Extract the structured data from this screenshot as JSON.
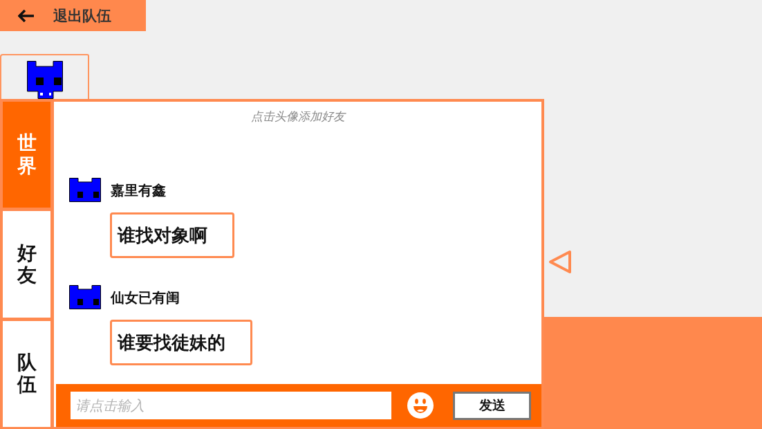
{
  "header": {
    "exit_button": "退出队伍"
  },
  "chat": {
    "tabs": [
      {
        "label": "世界",
        "selected": true
      },
      {
        "label": "好友",
        "selected": false
      },
      {
        "label": "队伍",
        "selected": false
      }
    ],
    "hint": "点击头像添加好友",
    "messages": [
      {
        "sender": "嘉里有鑫",
        "text": "谁找对象啊"
      },
      {
        "sender": "仙女已有闺",
        "text": "谁要找徒妹的"
      }
    ],
    "input": {
      "placeholder": "请点击输入"
    },
    "send_button": "发送"
  }
}
